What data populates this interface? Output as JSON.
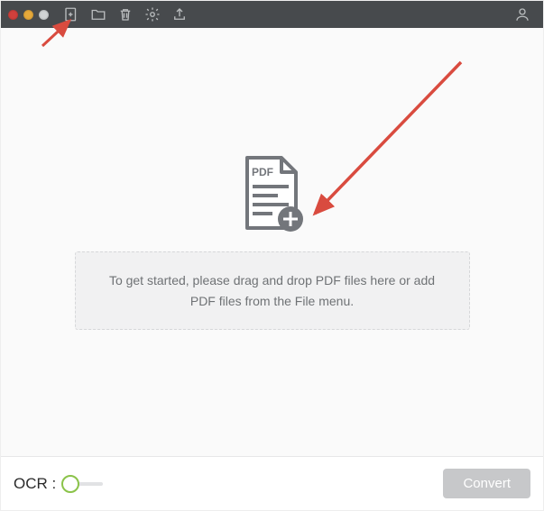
{
  "toolbar": {
    "add_file_icon": "add-file-icon",
    "open_folder_icon": "folder-icon",
    "delete_icon": "trash-icon",
    "settings_icon": "gear-icon",
    "export_icon": "export-up-icon",
    "account_icon": "account-icon"
  },
  "main": {
    "empty_pdf_icon_label": "PDF",
    "hint_text": "To get started, please drag and drop PDF files here or add PDF files from the File menu."
  },
  "bottom": {
    "ocr_label": "OCR :",
    "ocr_enabled": false,
    "convert_label": "Convert",
    "convert_enabled": false
  },
  "colors": {
    "toolbar_bg": "#474a4d",
    "icon": "#babdbf",
    "hint_text": "#6f7275",
    "toggle_accent": "#8bc34a",
    "convert_disabled_bg": "#c7c8ca",
    "annotation_arrow": "#d94b3f"
  }
}
